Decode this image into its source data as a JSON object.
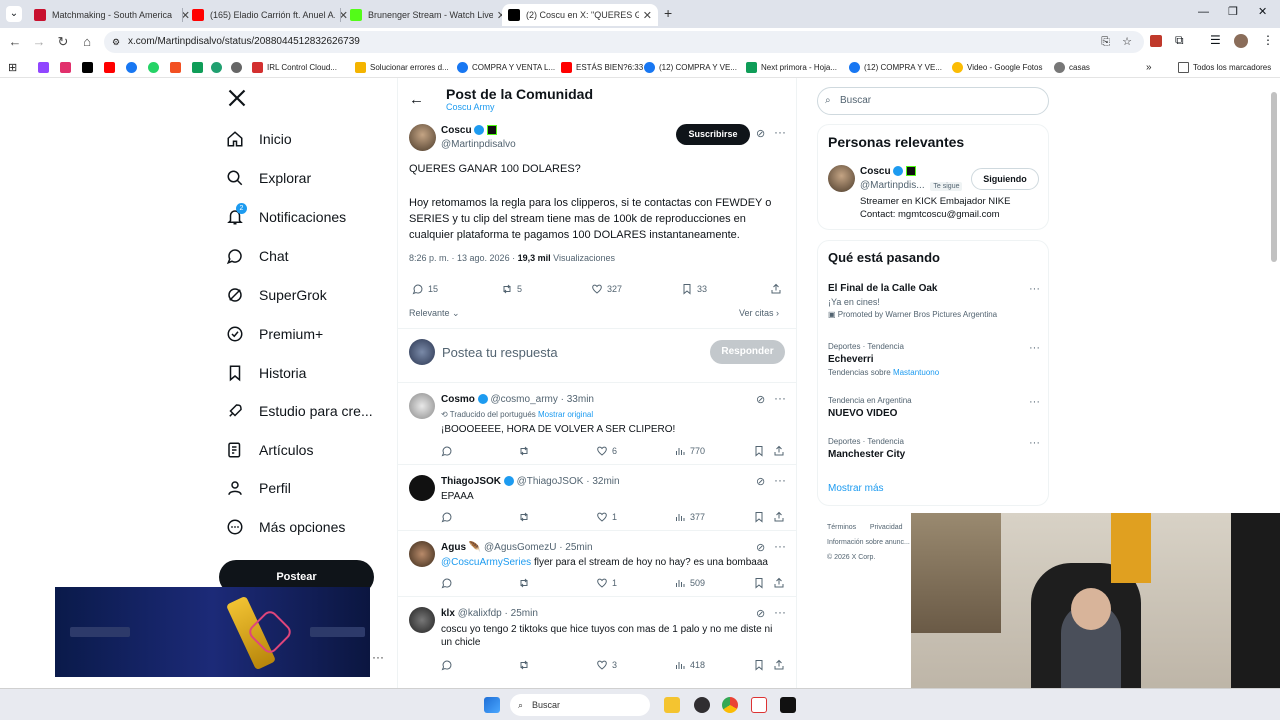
{
  "browser": {
    "tabs": [
      {
        "title": "Matchmaking - South America",
        "color": "#c8102e"
      },
      {
        "title": "(165) Eladio Carrión ft. Anuel A...",
        "color": "#ff0000"
      },
      {
        "title": "Brunenger Stream - Watch Live...",
        "color": "#53fc18"
      },
      {
        "title": "(2) Coscu en X: \"QUERES GANA...",
        "color": "#000000"
      }
    ],
    "url": "x.com/Martinpdisalvo/status/2088044512832626739",
    "bookmarks": [
      "IRL Control Cloud...",
      "Solucionar errores d...",
      "COMPRA Y VENTA L...",
      "ESTÁS BIEN?6:33",
      "(12) COMPRA Y VE...",
      "Next primora - Hoja...",
      "(12) COMPRA Y VE...",
      "Video - Google Fotos",
      "casas"
    ],
    "all_bookmarks": "Todos los marcadores"
  },
  "nav": {
    "items": [
      "Inicio",
      "Explorar",
      "Notificaciones",
      "Chat",
      "SuperGrok",
      "Premium+",
      "Historia",
      "Estudio para cre...",
      "Artículos",
      "Perfil",
      "Más opciones"
    ],
    "notif_badge": "2",
    "post_button": "Postear"
  },
  "post": {
    "header_title": "Post de la Comunidad",
    "community": "Coscu Army",
    "author": "Coscu",
    "handle": "@Martinpdisalvo",
    "subscribe": "Suscribirse",
    "line1": "QUERES GANAR 100 DOLARES?",
    "body": "Hoy retomamos la regla para los clipperos, si te contactas con FEWDEY o SERIES y tu clip del stream tiene mas de 100k de reproducciones en cualquier plataforma te pagamos 100 DOLARES instantaneamente.",
    "meta_time": "8:26 p. m. · 13 ago. 2026 · ",
    "views_count": "19,3 mil",
    "views_label": " Visualizaciones",
    "replies": "15",
    "reposts": "5",
    "likes": "327",
    "bookmarks": "33",
    "sort": "Relevante",
    "quotes": "Ver citas",
    "reply_placeholder": "Postea tu respuesta",
    "reply_button": "Responder"
  },
  "replies": [
    {
      "name": "Cosmo",
      "handle": "@cosmo_army",
      "time": "· 33min",
      "translated": "Traducido del portugués",
      "show_original": "Mostrar original",
      "text": "¡BOOOEEEE, HORA DE VOLVER A SER CLIPERO!",
      "replies": "",
      "reposts": "",
      "likes": "6",
      "views": "770"
    },
    {
      "name": "ThiagoJSOK",
      "handle": "@ThiagoJSOK",
      "time": "· 32min",
      "text": "EPAAA",
      "replies": "",
      "reposts": "",
      "likes": "1",
      "views": "377"
    },
    {
      "name": "Agus 🪶",
      "handle": "@AgusGomezU",
      "time": "· 25min",
      "mention": "@CoscuArmySeries",
      "text": " flyer para el stream de hoy no hay? es una bombaaa",
      "replies": "",
      "reposts": "",
      "likes": "1",
      "views": "509"
    },
    {
      "name": "klx",
      "handle": "@kalixfdp",
      "time": "· 25min",
      "text": "coscu yo tengo 2 tiktoks que hice tuyos con mas de 1 palo y no me diste ni un chicle",
      "replies": "",
      "reposts": "",
      "likes": "3",
      "views": "418"
    }
  ],
  "sidebar": {
    "search_placeholder": "Buscar",
    "relevant_title": "Personas relevantes",
    "person_name": "Coscu",
    "person_handle": "@Martinpdis...",
    "follows_you": "Te sigue",
    "following": "Siguiendo",
    "bio1": "Streamer en KICK Embajador NIKE",
    "bio2": "Contact: mgmtcoscu@gmail.com",
    "trending_title": "Qué está pasando",
    "trends": [
      {
        "meta": "",
        "title": "El Final de la Calle Oak",
        "sub": "¡Ya en cines!",
        "promo": "Promoted by Warner Bros Pictures Argentina"
      },
      {
        "meta": "Deportes · Tendencia",
        "title": "Echeverri",
        "sub": "Tendencias sobre ",
        "sub_link": "Mastantuono"
      },
      {
        "meta": "Tendencia en Argentina",
        "title": "NUEVO VIDEO"
      },
      {
        "meta": "Deportes · Tendencia",
        "title": "Manchester City"
      }
    ],
    "show_more": "Mostrar más",
    "footer1": "Términos",
    "footer2": "Privacidad",
    "footer3": "Información sobre anunc...",
    "footer4": "© 2026 X Corp."
  },
  "taskbar": {
    "search": "Buscar"
  }
}
